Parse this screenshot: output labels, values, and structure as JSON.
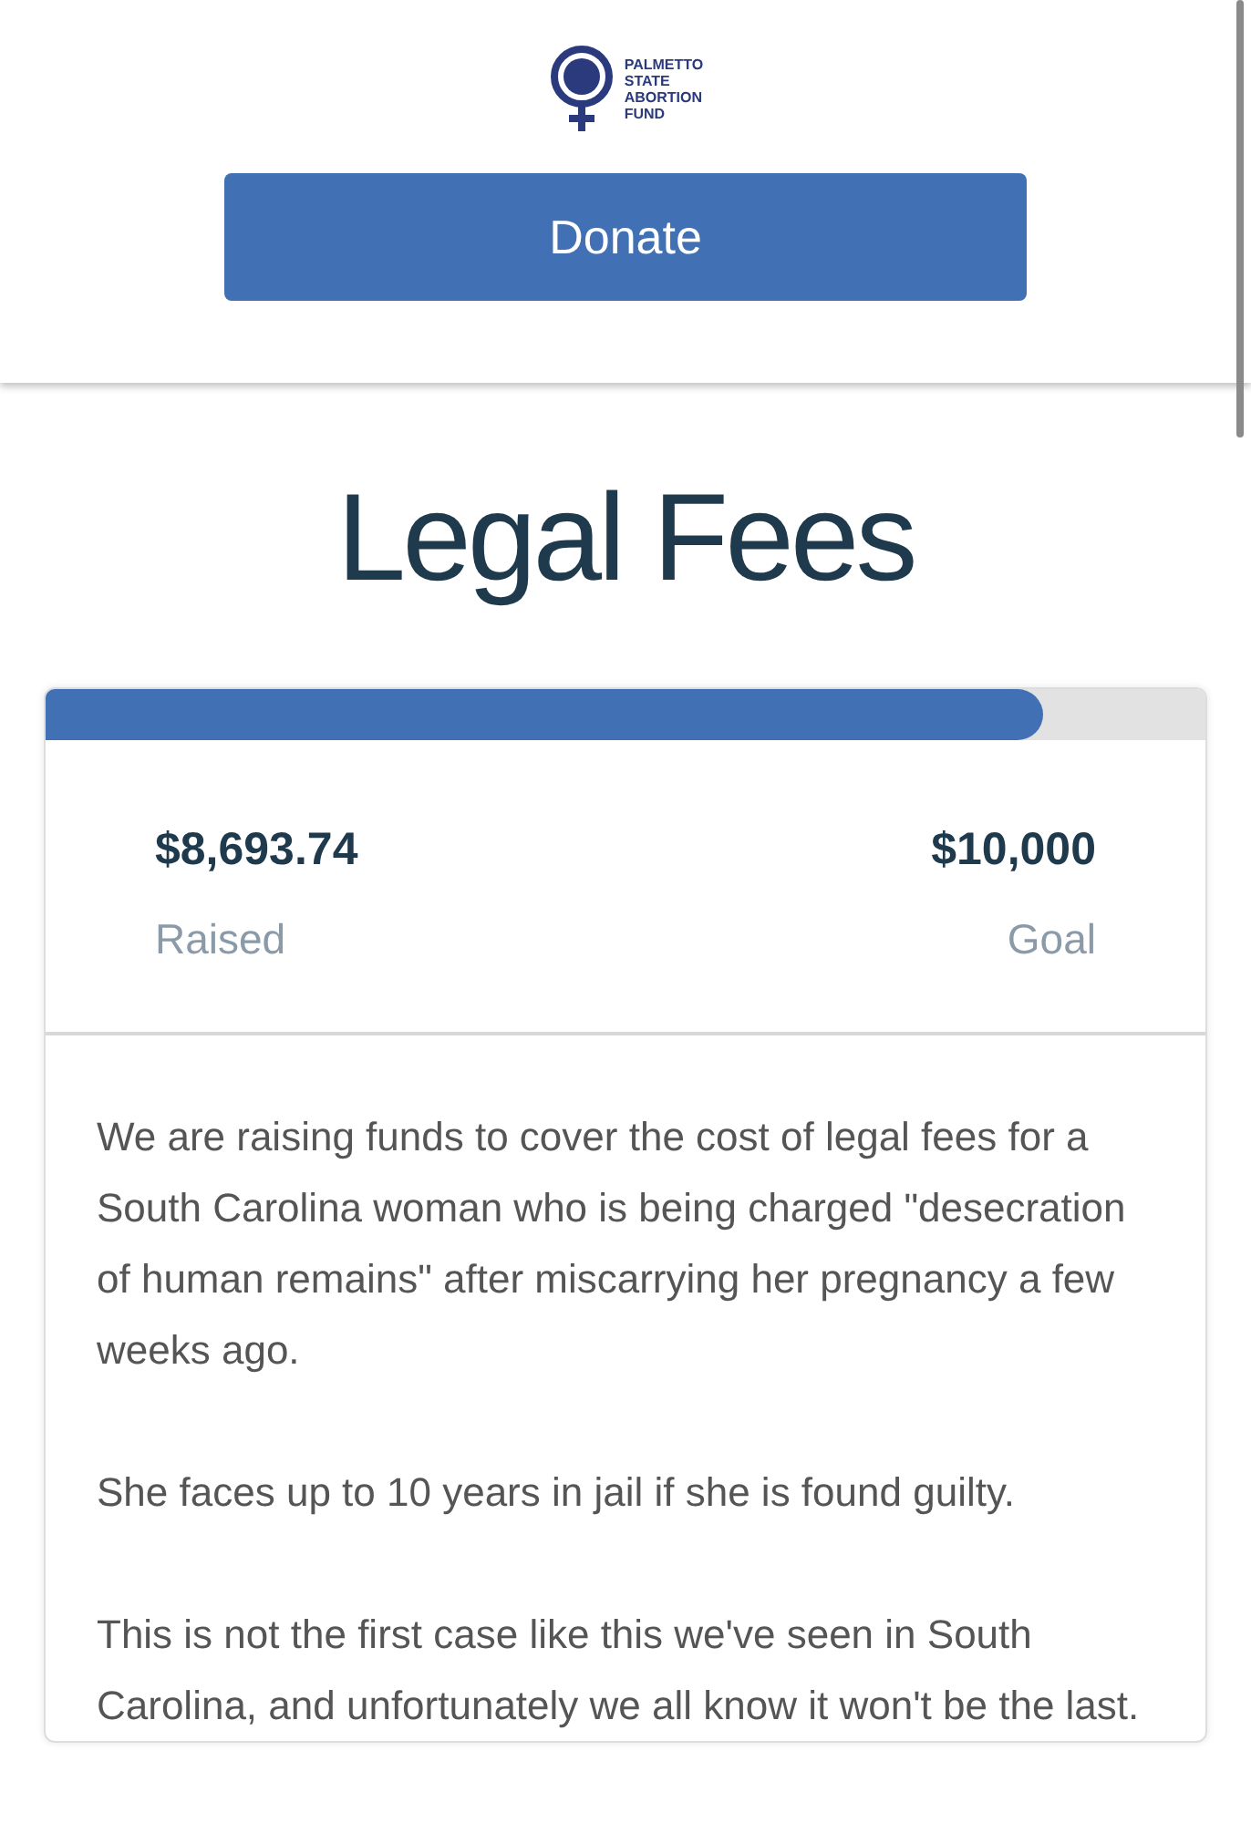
{
  "logo": {
    "lines": [
      "PALMETTO",
      "STATE",
      "ABORTION",
      "FUND"
    ]
  },
  "donate_button": "Donate",
  "title": "Legal Fees",
  "progress": {
    "level": 0.86
  },
  "stats": [
    {
      "amount": "$8,693.74",
      "label": "Raised"
    },
    {
      "amount": "$10,000",
      "label": "Goal"
    }
  ],
  "paragraphs": [
    "We are raising funds to cover the cost of legal fees for a South Carolina woman who is being charged \"desecration of human remains\" after miscarrying her pregnancy a few weeks ago.",
    "She faces up to 10 years in jail if she is found guilty.",
    "This is not the first case like this we've seen in South Carolina, and unfortunately we all know it won't be the last."
  ]
}
